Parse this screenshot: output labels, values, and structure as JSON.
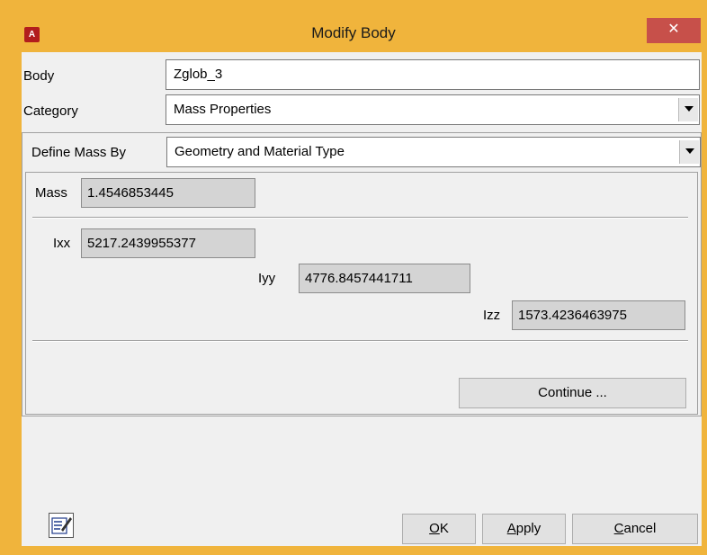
{
  "window": {
    "title": "Modify Body",
    "close_glyph": "✕",
    "app_icon_letter": "A"
  },
  "body_field": {
    "label": "Body",
    "value": "Zglob_3"
  },
  "category": {
    "label": "Category",
    "value": "Mass Properties"
  },
  "define_mass": {
    "label": "Define Mass By",
    "value": "Geometry and Material Type"
  },
  "mass": {
    "label": "Mass",
    "value": "1.4546853445"
  },
  "ixx": {
    "label": "Ixx",
    "value": "5217.2439955377"
  },
  "iyy": {
    "label": "Iyy",
    "value": "4776.8457441711"
  },
  "izz": {
    "label": "Izz",
    "value": "1573.4236463975"
  },
  "buttons": {
    "continue": "Continue ...",
    "ok_accel": "O",
    "ok_rest": "K",
    "apply_accel": "A",
    "apply_rest": "pply",
    "cancel_accel": "C",
    "cancel_rest": "ancel"
  },
  "icons": {
    "app": "app-icon",
    "close": "close-icon",
    "notes": "notes-icon"
  },
  "colors": {
    "frame": "#f0b43c",
    "close": "#c7504a",
    "app_icon": "#b21d1d"
  }
}
